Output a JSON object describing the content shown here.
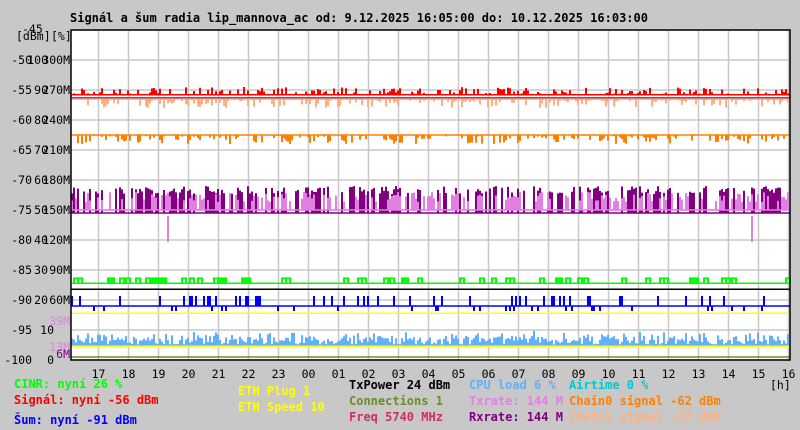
{
  "chart_data": {
    "type": "line",
    "title": "Signál a šum radia lip_mannova_ac od: 9.12.2025 16:05:00 do: 10.12.2025 16:03:00",
    "axis_units": {
      "dbm": "[dBm]",
      "pct": "[%]",
      "hours": "[h]"
    },
    "ylim_dbm": [
      -100,
      -45
    ],
    "y_ticks": [
      {
        "dbm": "-45",
        "pct": "",
        "rate": ""
      },
      {
        "dbm": "-50",
        "pct": "100",
        "rate": "300M"
      },
      {
        "dbm": "-55",
        "pct": "90",
        "rate": "270M"
      },
      {
        "dbm": "-60",
        "pct": "80",
        "rate": "240M"
      },
      {
        "dbm": "-65",
        "pct": "70",
        "rate": "210M"
      },
      {
        "dbm": "-70",
        "pct": "60",
        "rate": "180M"
      },
      {
        "dbm": "-75",
        "pct": "50",
        "rate": "150M"
      },
      {
        "dbm": "-80",
        "pct": "40",
        "rate": "120M"
      },
      {
        "dbm": "-85",
        "pct": "30",
        "rate": "90M"
      },
      {
        "dbm": "-90",
        "pct": "20",
        "rate": "60M"
      },
      {
        "dbm": "-95",
        "pct": "10",
        "rate": ""
      },
      {
        "dbm": "-100",
        "pct": "0",
        "rate": ""
      }
    ],
    "extra_rate_ticks": [
      {
        "label": "39M",
        "dbm": -93.5,
        "color": "#e080e0"
      },
      {
        "label": "13M",
        "dbm": -97.8,
        "color": "#e080e0"
      },
      {
        "label": "6M",
        "dbm": -99,
        "color": "#800080"
      }
    ],
    "x_ticks": [
      "17",
      "18",
      "19",
      "20",
      "21",
      "22",
      "23",
      "00",
      "01",
      "02",
      "03",
      "04",
      "05",
      "06",
      "07",
      "08",
      "09",
      "10",
      "11",
      "12",
      "13",
      "14",
      "15",
      "16"
    ],
    "grid": true,
    "series": [
      {
        "name": "Rxrate",
        "color": "#800080",
        "base": -71,
        "low": -75.5,
        "kind": "band"
      },
      {
        "name": "Txrate",
        "color": "#e080e0",
        "base": -72,
        "low": -75,
        "kind": "band2"
      },
      {
        "name": "Chain1 signal",
        "color": "#ffb080",
        "base": -56.5,
        "low": -58,
        "kind": "noisy"
      },
      {
        "name": "Signál",
        "color": "#ff0000",
        "base": -55.8,
        "low": -54.5,
        "kind": "noisy"
      },
      {
        "name": "Freq",
        "color": "#d03060",
        "base": -56.3,
        "low": -56.3,
        "kind": "flat"
      },
      {
        "name": "Chain0 signal",
        "color": "#ff8000",
        "base": -62.5,
        "low": -64,
        "kind": "noisy"
      },
      {
        "name": "CINR",
        "color": "#00ff00",
        "base": -87.2,
        "low": -86.4,
        "kind": "steps"
      },
      {
        "name": "TxPower",
        "color": "#000000",
        "base": -88.2,
        "low": -88.2,
        "kind": "flat"
      },
      {
        "name": "Šum",
        "color": "#0000ff",
        "base": -91,
        "low": -90,
        "kind": "steps2"
      },
      {
        "name": "ETH Speed",
        "color": "#ffff00",
        "base": -92.2,
        "low": -92.2,
        "kind": "flat"
      },
      {
        "name": "CPU load",
        "color": "#60b0ff",
        "base": -97.5,
        "low": -95.5,
        "kind": "noisy2"
      },
      {
        "name": "ETH Speed low",
        "color": "#ffff00",
        "base": -97.7,
        "low": -97.7,
        "kind": "flat"
      },
      {
        "name": "Connections",
        "color": "#6b8e23",
        "base": -99.5,
        "low": -99.5,
        "kind": "flat"
      }
    ]
  },
  "legend": {
    "col1": [
      {
        "text": "CINR: nyní 26 %",
        "color": "#00ff00"
      },
      {
        "text": "Signál: nyní -56 dBm",
        "color": "#ff0000"
      },
      {
        "text": "Šum: nyní -91 dBm",
        "color": "#0000ff"
      }
    ],
    "col2": [
      {
        "text": "ETH Plug 1",
        "color": "#ffff00"
      },
      {
        "text": "ETH Speed 10",
        "color": "#ffff00"
      }
    ],
    "col3": [
      {
        "text": "TxPower 24 dBm",
        "color": "#000000"
      },
      {
        "text": "Connections 1",
        "color": "#6b8e23"
      },
      {
        "text": "Freq 5740 MHz",
        "color": "#d03060"
      }
    ],
    "col4": [
      {
        "text": "CPU load 6 %",
        "color": "#60b0ff"
      },
      {
        "text": "Txrate: 144 M",
        "color": "#e080e0"
      },
      {
        "text": "Rxrate: 144 M",
        "color": "#800080"
      }
    ],
    "col5": [
      {
        "text": "Airtime 0 %",
        "color": "#00c8d0"
      },
      {
        "text": "Chain0 signal -62 dBm",
        "color": "#ff8000"
      },
      {
        "text": "Chain1 signal -57 dBm",
        "color": "#ffb080"
      }
    ]
  }
}
